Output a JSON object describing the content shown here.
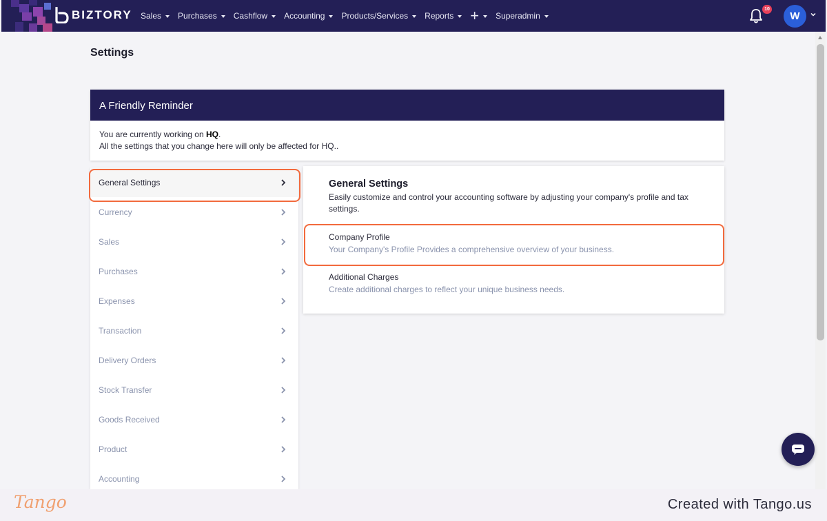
{
  "app": {
    "brand": "BIZTORY",
    "brand_color": "#231f56",
    "accent_color": "#f26a3d"
  },
  "nav": {
    "items": [
      {
        "label": "Sales",
        "icon": "chevron-down-icon"
      },
      {
        "label": "Purchases",
        "icon": "chevron-down-icon"
      },
      {
        "label": "Cashflow",
        "icon": "chevron-down-icon"
      },
      {
        "label": "Accounting",
        "icon": "chevron-down-icon"
      },
      {
        "label": "Products/Services",
        "icon": "chevron-down-icon"
      },
      {
        "label": "Reports",
        "icon": "chevron-down-icon"
      }
    ],
    "plus_icon": "plus-icon",
    "user_label": "Superadmin",
    "notifications_count": "10",
    "avatar_initial": "W"
  },
  "page": {
    "title": "Settings"
  },
  "reminder": {
    "title": "A Friendly Reminder",
    "line1_prefix": "You are currently working on ",
    "line1_branch": "HQ",
    "line1_suffix": ".",
    "line2": "All the settings that you change here will only be affected for HQ.."
  },
  "sidebar": {
    "items": [
      {
        "label": "General Settings",
        "active": true
      },
      {
        "label": "Currency"
      },
      {
        "label": "Sales"
      },
      {
        "label": "Purchases"
      },
      {
        "label": "Expenses"
      },
      {
        "label": "Transaction"
      },
      {
        "label": "Delivery Orders"
      },
      {
        "label": "Stock Transfer"
      },
      {
        "label": "Goods Received"
      },
      {
        "label": "Product"
      },
      {
        "label": "Accounting"
      }
    ]
  },
  "panel": {
    "title": "General Settings",
    "description": "Easily customize and control your accounting software by adjusting your company's profile and tax settings.",
    "options": [
      {
        "title": "Company Profile",
        "description": "Your Company's Profile Provides a comprehensive overview of your business."
      },
      {
        "title": "Additional Charges",
        "description": "Create additional charges to reflect your unique business needs."
      }
    ]
  },
  "footer": {
    "logo": "Tango",
    "created": "Created with Tango.us"
  }
}
